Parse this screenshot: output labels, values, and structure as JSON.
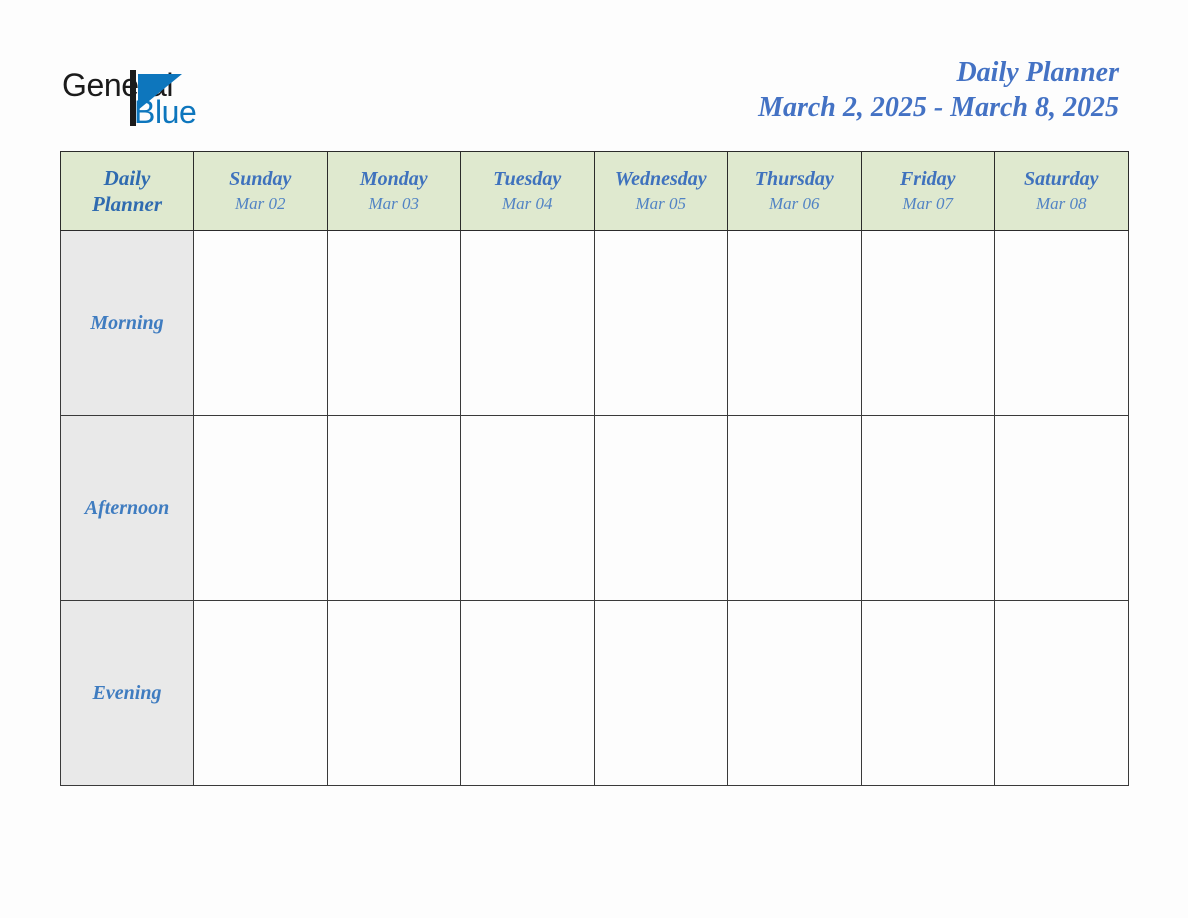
{
  "document": {
    "type": "weekly-daily-planner"
  },
  "brand": {
    "name_part1": "General",
    "name_part2": "Blue",
    "mark_icon": "blue-triangle-flag-icon",
    "color_part1": "#1b1b1b",
    "color_part2": "#0d76bd"
  },
  "header": {
    "title": "Daily Planner",
    "date_range": "March 2, 2025 - March 8, 2025",
    "title_color": "#4472c4"
  },
  "table": {
    "corner": {
      "line1": "Daily",
      "line2": "Planner"
    },
    "header_bg": "#dfe9cf",
    "label_bg": "#e9e9e9",
    "cell_bg": "#fdfdfd",
    "border_color": "#2b2b2b",
    "columns": [
      {
        "day": "Sunday",
        "date": "Mar 02"
      },
      {
        "day": "Monday",
        "date": "Mar 03"
      },
      {
        "day": "Tuesday",
        "date": "Mar 04"
      },
      {
        "day": "Wednesday",
        "date": "Mar 05"
      },
      {
        "day": "Thursday",
        "date": "Mar 06"
      },
      {
        "day": "Friday",
        "date": "Mar 07"
      },
      {
        "day": "Saturday",
        "date": "Mar 08"
      }
    ],
    "rows": [
      {
        "label": "Morning",
        "entries": [
          "",
          "",
          "",
          "",
          "",
          "",
          ""
        ]
      },
      {
        "label": "Afternoon",
        "entries": [
          "",
          "",
          "",
          "",
          "",
          "",
          ""
        ]
      },
      {
        "label": "Evening",
        "entries": [
          "",
          "",
          "",
          "",
          "",
          "",
          ""
        ]
      }
    ]
  }
}
